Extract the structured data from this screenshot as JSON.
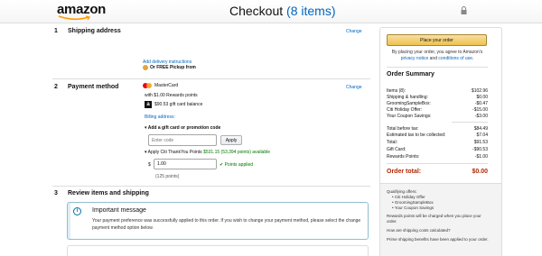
{
  "header": {
    "logo": "amazon",
    "title": "Checkout",
    "item_count": "(8 items)"
  },
  "shipping": {
    "num": "1",
    "title": "Shipping address",
    "change": "Change",
    "delivery_instructions": "Add delivery instructions",
    "pickup": "Or FREE Pickup from"
  },
  "payment": {
    "num": "2",
    "title": "Payment method",
    "change": "Change",
    "card_name": "MasterCard",
    "rewards": "with $1.00 Rewards points",
    "gift_balance": "$90.53 gift card balance",
    "billing": "Billing address:",
    "promo_title": "Add a gift card or promotion code",
    "promo_placeholder": "Enter code",
    "apply": "Apply",
    "citi_prefix": "Apply Citi ThankYou Points ",
    "citi_points": "$531.15 (53,394 points) available",
    "dollar": "$",
    "points_value": "1.00",
    "points_applied": "Points applied",
    "points_count": "(125 points)"
  },
  "review": {
    "num": "3",
    "title": "Review items and shipping",
    "important_title": "Important message",
    "important_text": "Your payment preference was successfully applied to this order. If you wish to change your payment method, please select the change payment method option below."
  },
  "summary": {
    "place_order": "Place your order",
    "agree_text": "By placing your order, you agree to Amazon's",
    "privacy": "privacy notice",
    "and": " and ",
    "conditions": "conditions of use",
    "title": "Order Summary",
    "rows": [
      {
        "label": "Items (8):",
        "value": "$102.96"
      },
      {
        "label": "Shipping & handling:",
        "value": "$0.00"
      },
      {
        "label": "GroomingSampleBox:",
        "value": "-$0.47"
      },
      {
        "label": "Citi Holiday Offer:",
        "value": "-$15.00"
      },
      {
        "label": "Your Coupon Savings:",
        "value": "-$3.00"
      }
    ],
    "rows2": [
      {
        "label": "Total before tax:",
        "value": "$84.49"
      },
      {
        "label": "Estimated tax to be collected:",
        "value": "$7.04"
      },
      {
        "label": "Total:",
        "value": "$91.53"
      },
      {
        "label": "Gift Card:",
        "value": "-$90.53"
      },
      {
        "label": "Rewards Points:",
        "value": "-$1.00"
      }
    ],
    "order_total_label": "Order total:",
    "order_total_value": "$0.00",
    "qualifying": "Qualifying offers:",
    "offers": [
      "Citi Holiday Offer",
      "GroomingSampleBox",
      "Your Coupon Savings"
    ],
    "rewards_note": "Rewards points will be charged when you place your order.",
    "shipping_calc": "How are shipping costs calculated?",
    "prime_note": "Prime shipping benefits have been applied to your order."
  },
  "colors": {
    "link": "#0066c0",
    "order_total": "#b12704",
    "success": "#007600",
    "button": "#f0c14b"
  }
}
